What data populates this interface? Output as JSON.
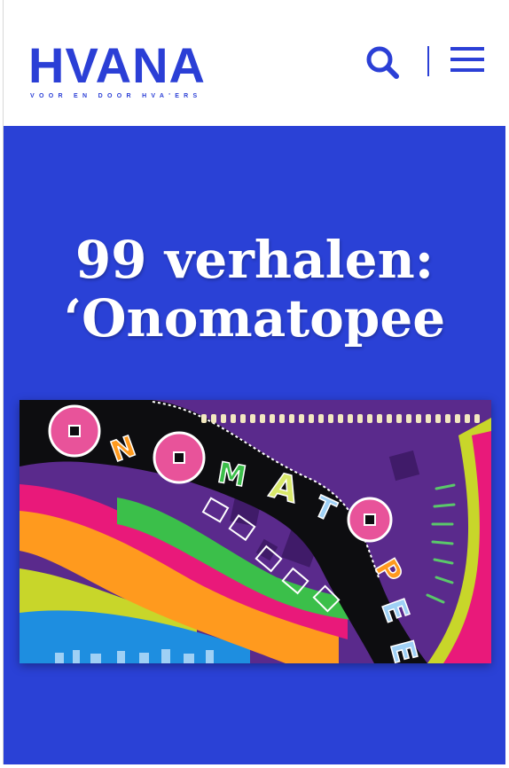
{
  "header": {
    "logo_text": "HVANA",
    "logo_tagline": "VOOR EN DOOR HVA'ERS",
    "search_icon": "search-icon",
    "menu_icon": "hamburger-menu-icon"
  },
  "article": {
    "title_line1": "99 verhalen:",
    "title_line2": "‘Onomatopee"
  },
  "hero_image": {
    "letters": "ONOMATOPEE"
  },
  "colors": {
    "brand_blue": "#2b3fd6",
    "hero_background": "#2a41d6",
    "title_text": "#ffffff"
  }
}
